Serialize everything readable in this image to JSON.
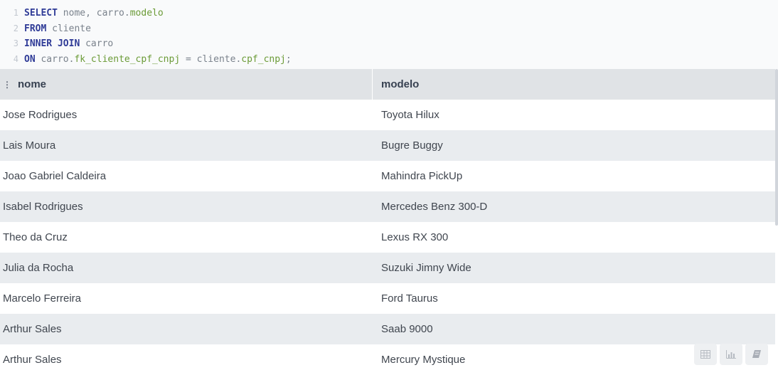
{
  "query": {
    "lines": [
      {
        "num": "1",
        "parts": [
          {
            "t": "SELECT",
            "k": "kw"
          },
          {
            "t": " nome, carro.",
            "k": "tx"
          },
          {
            "t": "modelo",
            "k": "gr"
          }
        ]
      },
      {
        "num": "2",
        "parts": [
          {
            "t": "FROM",
            "k": "kw"
          },
          {
            "t": " cliente",
            "k": "tx"
          }
        ]
      },
      {
        "num": "3",
        "parts": [
          {
            "t": "INNER JOIN",
            "k": "kw"
          },
          {
            "t": " carro",
            "k": "tx"
          }
        ]
      },
      {
        "num": "4",
        "parts": [
          {
            "t": "ON",
            "k": "kw"
          },
          {
            "t": " carro.",
            "k": "tx"
          },
          {
            "t": "fk_cliente_cpf_cnpj",
            "k": "gr"
          },
          {
            "t": " = cliente.",
            "k": "tx"
          },
          {
            "t": "cpf_cnpj",
            "k": "gr"
          },
          {
            "t": ";",
            "k": "tx"
          }
        ]
      }
    ]
  },
  "table": {
    "columns": [
      "nome",
      "modelo"
    ],
    "rows": [
      [
        "Jose Rodrigues",
        "Toyota Hilux"
      ],
      [
        "Lais Moura",
        "Bugre Buggy"
      ],
      [
        "Joao Gabriel Caldeira",
        "Mahindra PickUp"
      ],
      [
        "Isabel Rodrigues",
        "Mercedes Benz 300-D"
      ],
      [
        "Theo da Cruz",
        "Lexus RX 300"
      ],
      [
        "Julia da Rocha",
        "Suzuki Jimny Wide"
      ],
      [
        "Marcelo Ferreira",
        "Ford Taurus"
      ],
      [
        "Arthur Sales",
        "Saab 9000"
      ],
      [
        "Arthur Sales",
        "Mercury Mystique"
      ]
    ]
  },
  "toolbar": {
    "buttons": [
      "table-view-icon",
      "chart-view-icon",
      "notebook-icon"
    ]
  },
  "colors": {
    "keyword": "#2f3b97",
    "identifier": "#6b9b37",
    "header_bg": "#e0e3e6",
    "alt_row_bg": "#e9ecef"
  }
}
